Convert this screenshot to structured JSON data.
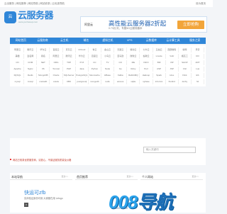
{
  "topbar": {
    "left_text": "云出服务 | 网站推荐 | 网站导航 | 网站收录 | 云优选导航",
    "right_text": "设为首页"
  },
  "logo": {
    "name": "云服务器",
    "url": "www.yunfuwuqi.com",
    "mark": "云"
  },
  "banner": {
    "brand": "阿里云",
    "title": "高性能云服务器2折起",
    "subtitle": "0.73元/天，专属5G云服务器本",
    "button": "立即抢购"
  },
  "nav": {
    "items": [
      "网站首页",
      "云服务商",
      "云主机",
      "域名",
      "虚拟主机",
      "VPS",
      "云数据库",
      "云计算工具",
      "服务之家"
    ]
  },
  "links": {
    "rows": [
      [
        "阿里云",
        "腾讯云",
        "华为云",
        "百度云",
        "京东云",
        "UCloud",
        "青云",
        "金山云",
        "天翼云",
        "移动云",
        "七牛云",
        "又拍云",
        "西部数码",
        "新网",
        "景安"
      ],
      [
        "美橙",
        "爱名网",
        "易名",
        "阿里云",
        "腾讯云",
        "华为云",
        "百度云",
        "小鸟云",
        "亚马逊",
        "微软云",
        "谷歌云",
        "Linode",
        "Vultr",
        "搬瓦工",
        "DO"
      ],
      [
        "CN",
        "COM",
        "NET",
        "ORG",
        "TOP",
        "XYZ",
        "CC",
        "TV",
        "CO",
        "ME",
        "INFO",
        "BIZ",
        "VIP",
        "SHOP",
        "APP"
      ],
      [
        "Apache",
        "Nginx",
        "IIS",
        "Tomcat",
        "PHP",
        "Java",
        "Python",
        "Node",
        "Go",
        "Ruby",
        "Perl",
        "ASP",
        "JSP",
        "CGI",
        "Lua"
      ],
      [
        "MySQL",
        "Redis",
        "MongoDB",
        "Oracle",
        "SQLServer",
        "PostgreSQL",
        "Memcache",
        "HBase",
        "Kafka",
        "RabbitMQ",
        "Hadoop",
        "Spark",
        "Hive",
        "Flink",
        "ES"
      ],
      [
        "mysql",
        "mssql",
        "mariadb",
        "oracle",
        "DB2",
        "postgresql",
        "mongodb",
        "redis",
        "access",
        "sqlite",
        "sybase",
        "informix",
        "firebird",
        "derby",
        "h2"
      ]
    ]
  },
  "search": {
    "placeholder": "输入关键词",
    "notice": "网站已收录优质服务商，请放心，不保证服务质量及价格"
  },
  "columns": [
    {
      "head": "本站导航",
      "more": "更多>>"
    },
    {
      "head": "首页推荐",
      "more": "更多>>"
    },
    {
      "head": "个人网站",
      "more": "更多>>"
    }
  ],
  "ad": {
    "title": "快运可zfb",
    "subtitle": "实体验证身份可用 大家都在用 Letsgo",
    "close": "×"
  },
  "watermark": {
    "text_a": "008",
    "text_b": "导航",
    "sub": "008DH.COM"
  }
}
